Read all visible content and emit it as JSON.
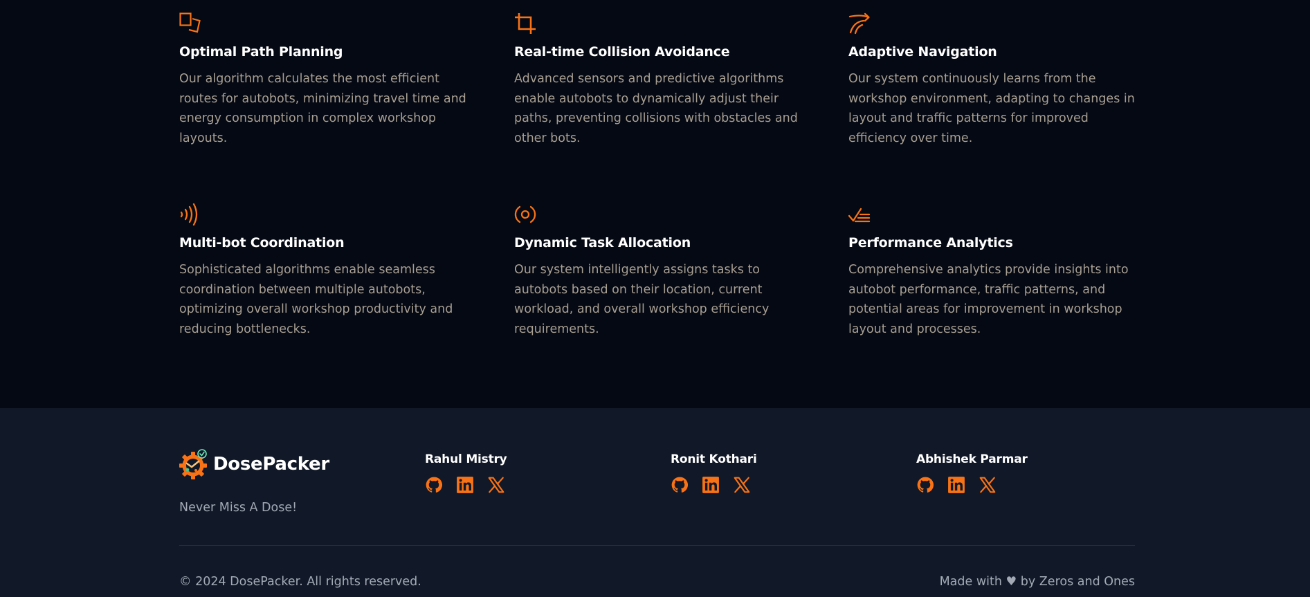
{
  "features": [
    {
      "icon": "path-planning-icon",
      "title": "Optimal Path Planning",
      "description": "Our algorithm calculates the most efficient routes for autobots, minimizing travel time and energy consumption in complex workshop layouts."
    },
    {
      "icon": "crop-icon",
      "title": "Real-time Collision Avoidance",
      "description": "Advanced sensors and predictive algorithms enable autobots to dynamically adjust their paths, preventing collisions with obstacles and other bots."
    },
    {
      "icon": "route-arrow-icon",
      "title": "Adaptive Navigation",
      "description": "Our system continuously learns from the workshop environment, adapting to changes in layout and traffic patterns for improved efficiency over time."
    },
    {
      "icon": "signal-waves-icon",
      "title": "Multi-bot Coordination",
      "description": "Sophisticated algorithms enable seamless coordination between multiple autobots, optimizing overall workshop productivity and reducing bottlenecks."
    },
    {
      "icon": "radio-broadcast-icon",
      "title": "Dynamic Task Allocation",
      "description": "Our system intelligently assigns tasks to autobots based on their location, current workload, and overall workshop efficiency requirements."
    },
    {
      "icon": "checklist-icon",
      "title": "Performance Analytics",
      "description": "Comprehensive analytics provide insights into autobot performance, traffic patterns, and potential areas for improvement in workshop layout and processes."
    }
  ],
  "footer": {
    "brand_name": "DosePacker",
    "tagline": "Never Miss A Dose!",
    "members": [
      {
        "name": "Rahul Mistry",
        "socials": [
          "github-icon",
          "linkedin-icon",
          "x-icon"
        ]
      },
      {
        "name": "Ronit Kothari",
        "socials": [
          "github-icon",
          "linkedin-icon",
          "x-icon"
        ]
      },
      {
        "name": "Abhishek Parmar",
        "socials": [
          "github-icon",
          "linkedin-icon",
          "x-icon"
        ]
      }
    ],
    "copyright": "© 2024 DosePacker. All rights reserved.",
    "credit": "Made with ♥ by Zeros and Ones"
  },
  "colors": {
    "background": "#050913",
    "footer_background": "#111827",
    "accent": "#f97316",
    "heading": "#ffffff",
    "body_text": "#a89f93",
    "muted_text": "#a3aab6"
  }
}
